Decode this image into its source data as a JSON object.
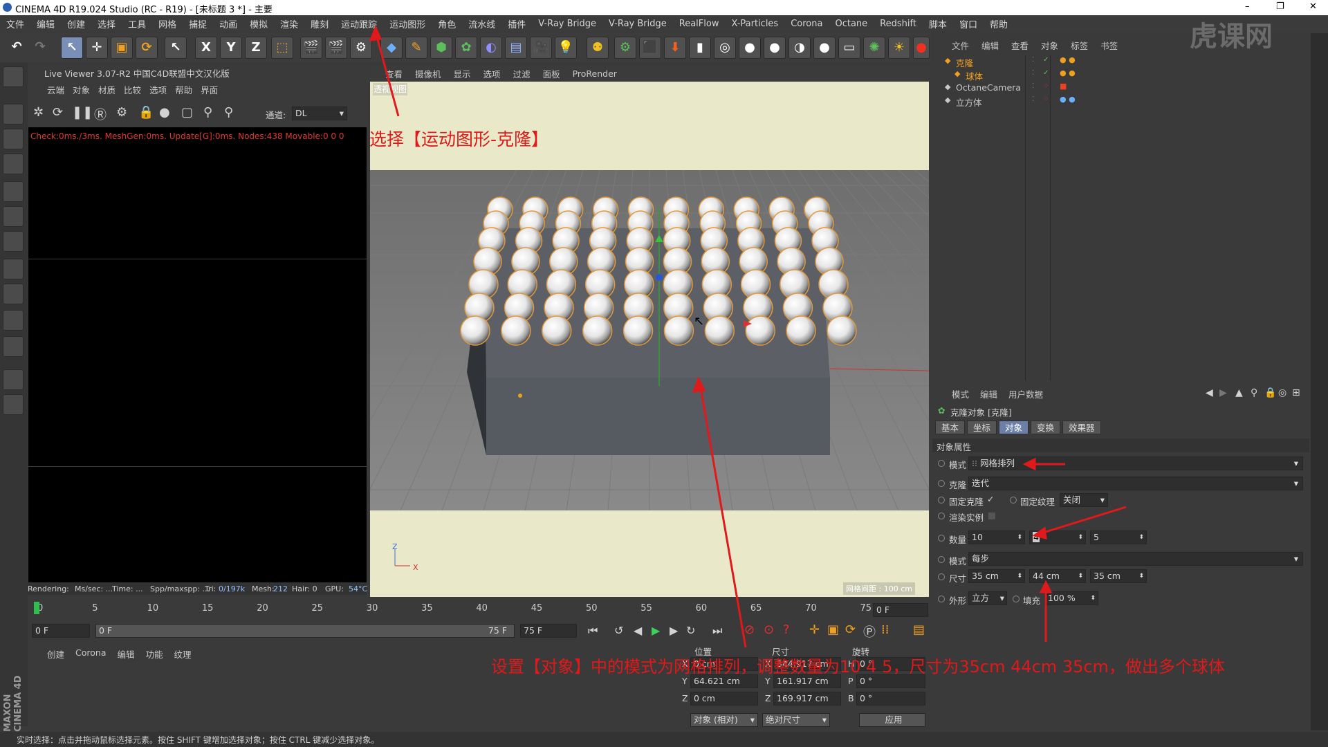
{
  "titlebar": {
    "title": "CINEMA 4D R19.024 Studio (RC - R19) - [未标题 3 *] - 主要",
    "minimize": "–",
    "restore": "❐",
    "close": "✕"
  },
  "menubar": [
    "文件",
    "编辑",
    "创建",
    "选择",
    "工具",
    "网格",
    "捕捉",
    "动画",
    "模拟",
    "渲染",
    "雕刻",
    "运动跟踪",
    "运动图形",
    "角色",
    "流水线",
    "插件",
    "V-Ray Bridge",
    "V-Ray Bridge",
    "RealFlow",
    "X-Particles",
    "Corona",
    "Octane",
    "Redshift",
    "脚本",
    "窗口",
    "帮助"
  ],
  "toolbar": {
    "x_label": "X",
    "y_label": "Y",
    "z_label": "Z"
  },
  "liveviewer": {
    "title": "Live Viewer 3.07-R2 中国C4D联盟中文汉化版",
    "menu": [
      "云端",
      "对象",
      "材质",
      "比较",
      "选项",
      "帮助",
      "界面"
    ],
    "channel_label": "通道:",
    "channel_value": "DL",
    "log": "Check:0ms./3ms. MeshGen:0ms. Update[G]:0ms. Nodes:438 Movable:0  0 0",
    "status": {
      "rendering": "Rendering:",
      "ms": "Ms/sec: ...",
      "time": "Time: ...",
      "spp": "Spp/maxspp: ...",
      "tri_label": "Tri:",
      "tri_value": "0/197k",
      "mesh_label": "Mesh:",
      "mesh_value": "212",
      "hair": "Hair: 0",
      "gpu_label": "GPU:",
      "gpu_value": "54°C"
    }
  },
  "viewport": {
    "menu": [
      "查看",
      "摄像机",
      "显示",
      "选项",
      "过滤",
      "面板",
      "ProRender"
    ],
    "corner_label": "透视视图",
    "grid_info": "网格间距 : 100 cm",
    "axis_z": "Z",
    "axis_x": "X"
  },
  "annotations": {
    "top": "选择【运动图形-克隆】",
    "bottom": "设置【对象】中的模式为网格排列，调整数量为10 4 5，尺寸为35cm 44cm 35cm，做出多个球体"
  },
  "objmgr": {
    "menu": [
      "文件",
      "编辑",
      "查看",
      "对象",
      "标签",
      "书签"
    ],
    "objects": [
      {
        "name": "克隆",
        "indent": 0,
        "color": "#f0a020"
      },
      {
        "name": "球体",
        "indent": 1,
        "color": "#f0a020"
      },
      {
        "name": "OctaneCamera",
        "indent": 0,
        "color": "#c8c8c8"
      },
      {
        "name": "立方体",
        "indent": 0,
        "color": "#c8c8c8"
      }
    ]
  },
  "attrmgr": {
    "menu": [
      "模式",
      "编辑",
      "用户数据"
    ],
    "object_title": "克隆对象 [克隆]",
    "tabs": [
      "基本",
      "坐标",
      "对象",
      "变换",
      "效果器"
    ],
    "active_tab": "对象",
    "section": "对象属性",
    "mode_label": "模式",
    "mode_value": "网格排列",
    "clone_label": "克隆",
    "clone_value": "迭代",
    "fix_clone": "固定克隆",
    "fix_clone_check": "✓",
    "fix_texture": "固定纹理",
    "fix_texture_value": "关闭",
    "render_instance": "渲染实例",
    "count_label": "数量",
    "count": [
      "10",
      "4",
      "5"
    ],
    "mode2_label": "模式",
    "mode2_value": "每步",
    "size_label": "尺寸",
    "size": [
      "35 cm",
      "44 cm",
      "35 cm"
    ],
    "shape_label": "外形",
    "shape_value": "立方",
    "fill_label": "填充",
    "fill_value": "100 %"
  },
  "timeline": {
    "ticks": [
      "0",
      "5",
      "10",
      "15",
      "20",
      "25",
      "30",
      "35",
      "40",
      "45",
      "50",
      "55",
      "60",
      "65",
      "70",
      "75"
    ],
    "end_frame": "0 F",
    "cur_frame": "0 F",
    "range_start": "0 F",
    "range_end": "75 F",
    "max_frame": "75 F"
  },
  "matmgr": {
    "menu": [
      "创建",
      "Corona",
      "编辑",
      "功能",
      "纹理"
    ],
    "brand": "MAXON CINEMA 4D"
  },
  "coords": {
    "headers": [
      "位置",
      "尺寸",
      "旋转"
    ],
    "rows": [
      {
        "axis": "X",
        "pos": "0 cm",
        "saxis": "X",
        "size": "344.917 cm",
        "raxis": "H",
        "rot": "0 °"
      },
      {
        "axis": "Y",
        "pos": "64.621 cm",
        "saxis": "Y",
        "size": "161.917 cm",
        "raxis": "P",
        "rot": "0 °"
      },
      {
        "axis": "Z",
        "pos": "0 cm",
        "saxis": "Z",
        "size": "169.917 cm",
        "raxis": "B",
        "rot": "0 °"
      }
    ],
    "mode1": "对象 (相对)",
    "mode2": "绝对尺寸",
    "apply": "应用"
  },
  "statusbar": "实时选择：点击并拖动鼠标选择元素。按住 SHIFT 键增加选择对象；按住 CTRL 键减少选择对象。",
  "watermark": "虎课网",
  "colors": {
    "accent": "#6b7fa8",
    "annotation": "#e0191a",
    "viewport_bg": "#e9e9c9"
  }
}
